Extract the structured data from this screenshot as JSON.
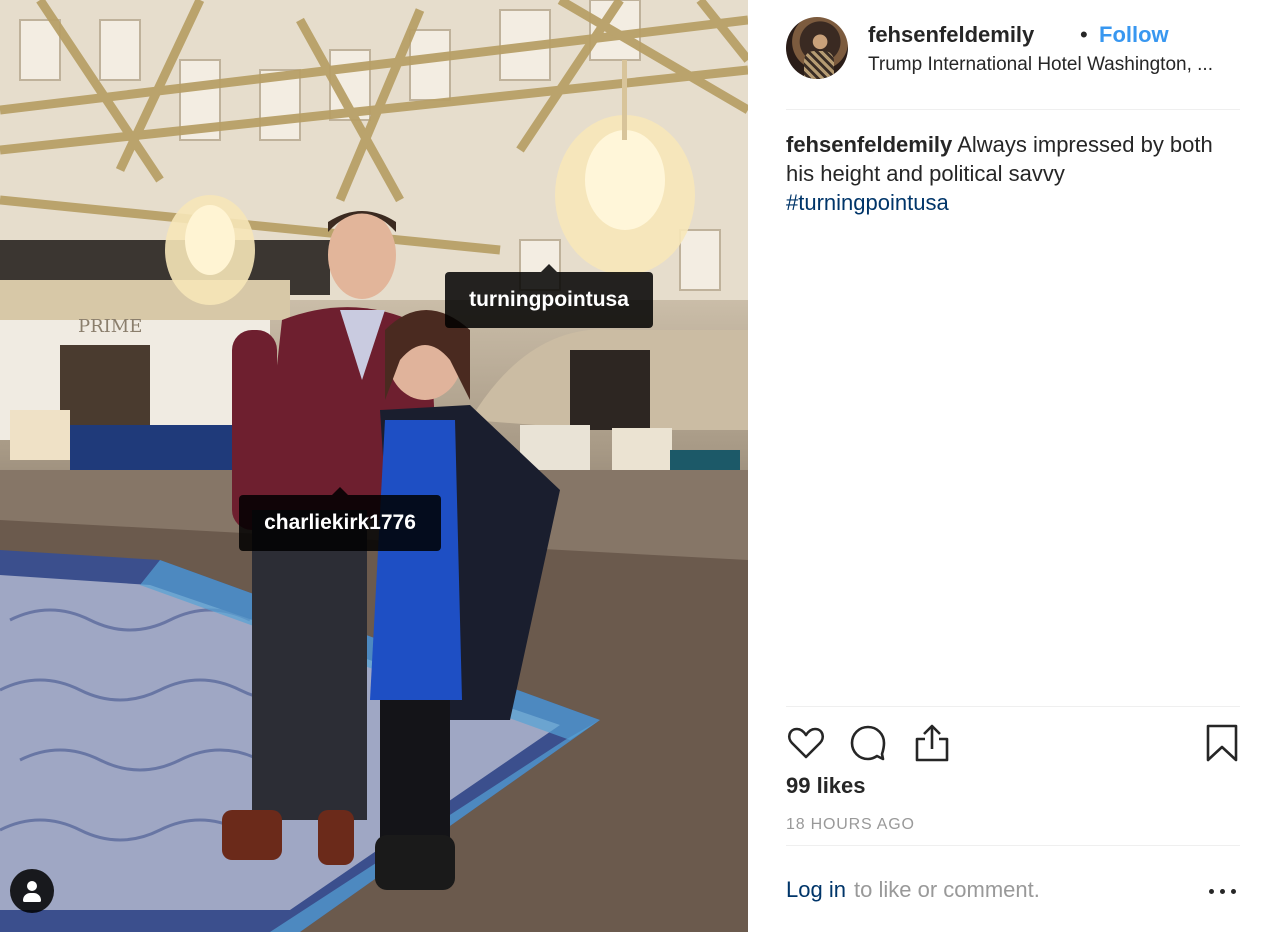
{
  "post": {
    "username": "fehsenfeldemily",
    "separator": "•",
    "follow_label": "Follow",
    "location": "Trump International Hotel Washington, ...",
    "caption_text": "Always impressed by both his height and political savvy",
    "hashtag": "#turningpointusa",
    "likes": "99 likes",
    "timestamp": "18 HOURS AGO"
  },
  "photo": {
    "tags": [
      "turningpointusa",
      "charliekirk1776"
    ],
    "sign_text": "PRIME"
  },
  "footer": {
    "login_label": "Log in",
    "login_rest": "to like or comment."
  },
  "icons": {
    "like": "heart-icon",
    "comment": "comment-icon",
    "share": "share-icon",
    "save": "bookmark-icon",
    "more": "more-options-icon",
    "user_tags": "user-tags-icon"
  },
  "colors": {
    "follow": "#3897f0",
    "link": "#003569",
    "muted": "#999999",
    "tag_bg": "#000000"
  }
}
